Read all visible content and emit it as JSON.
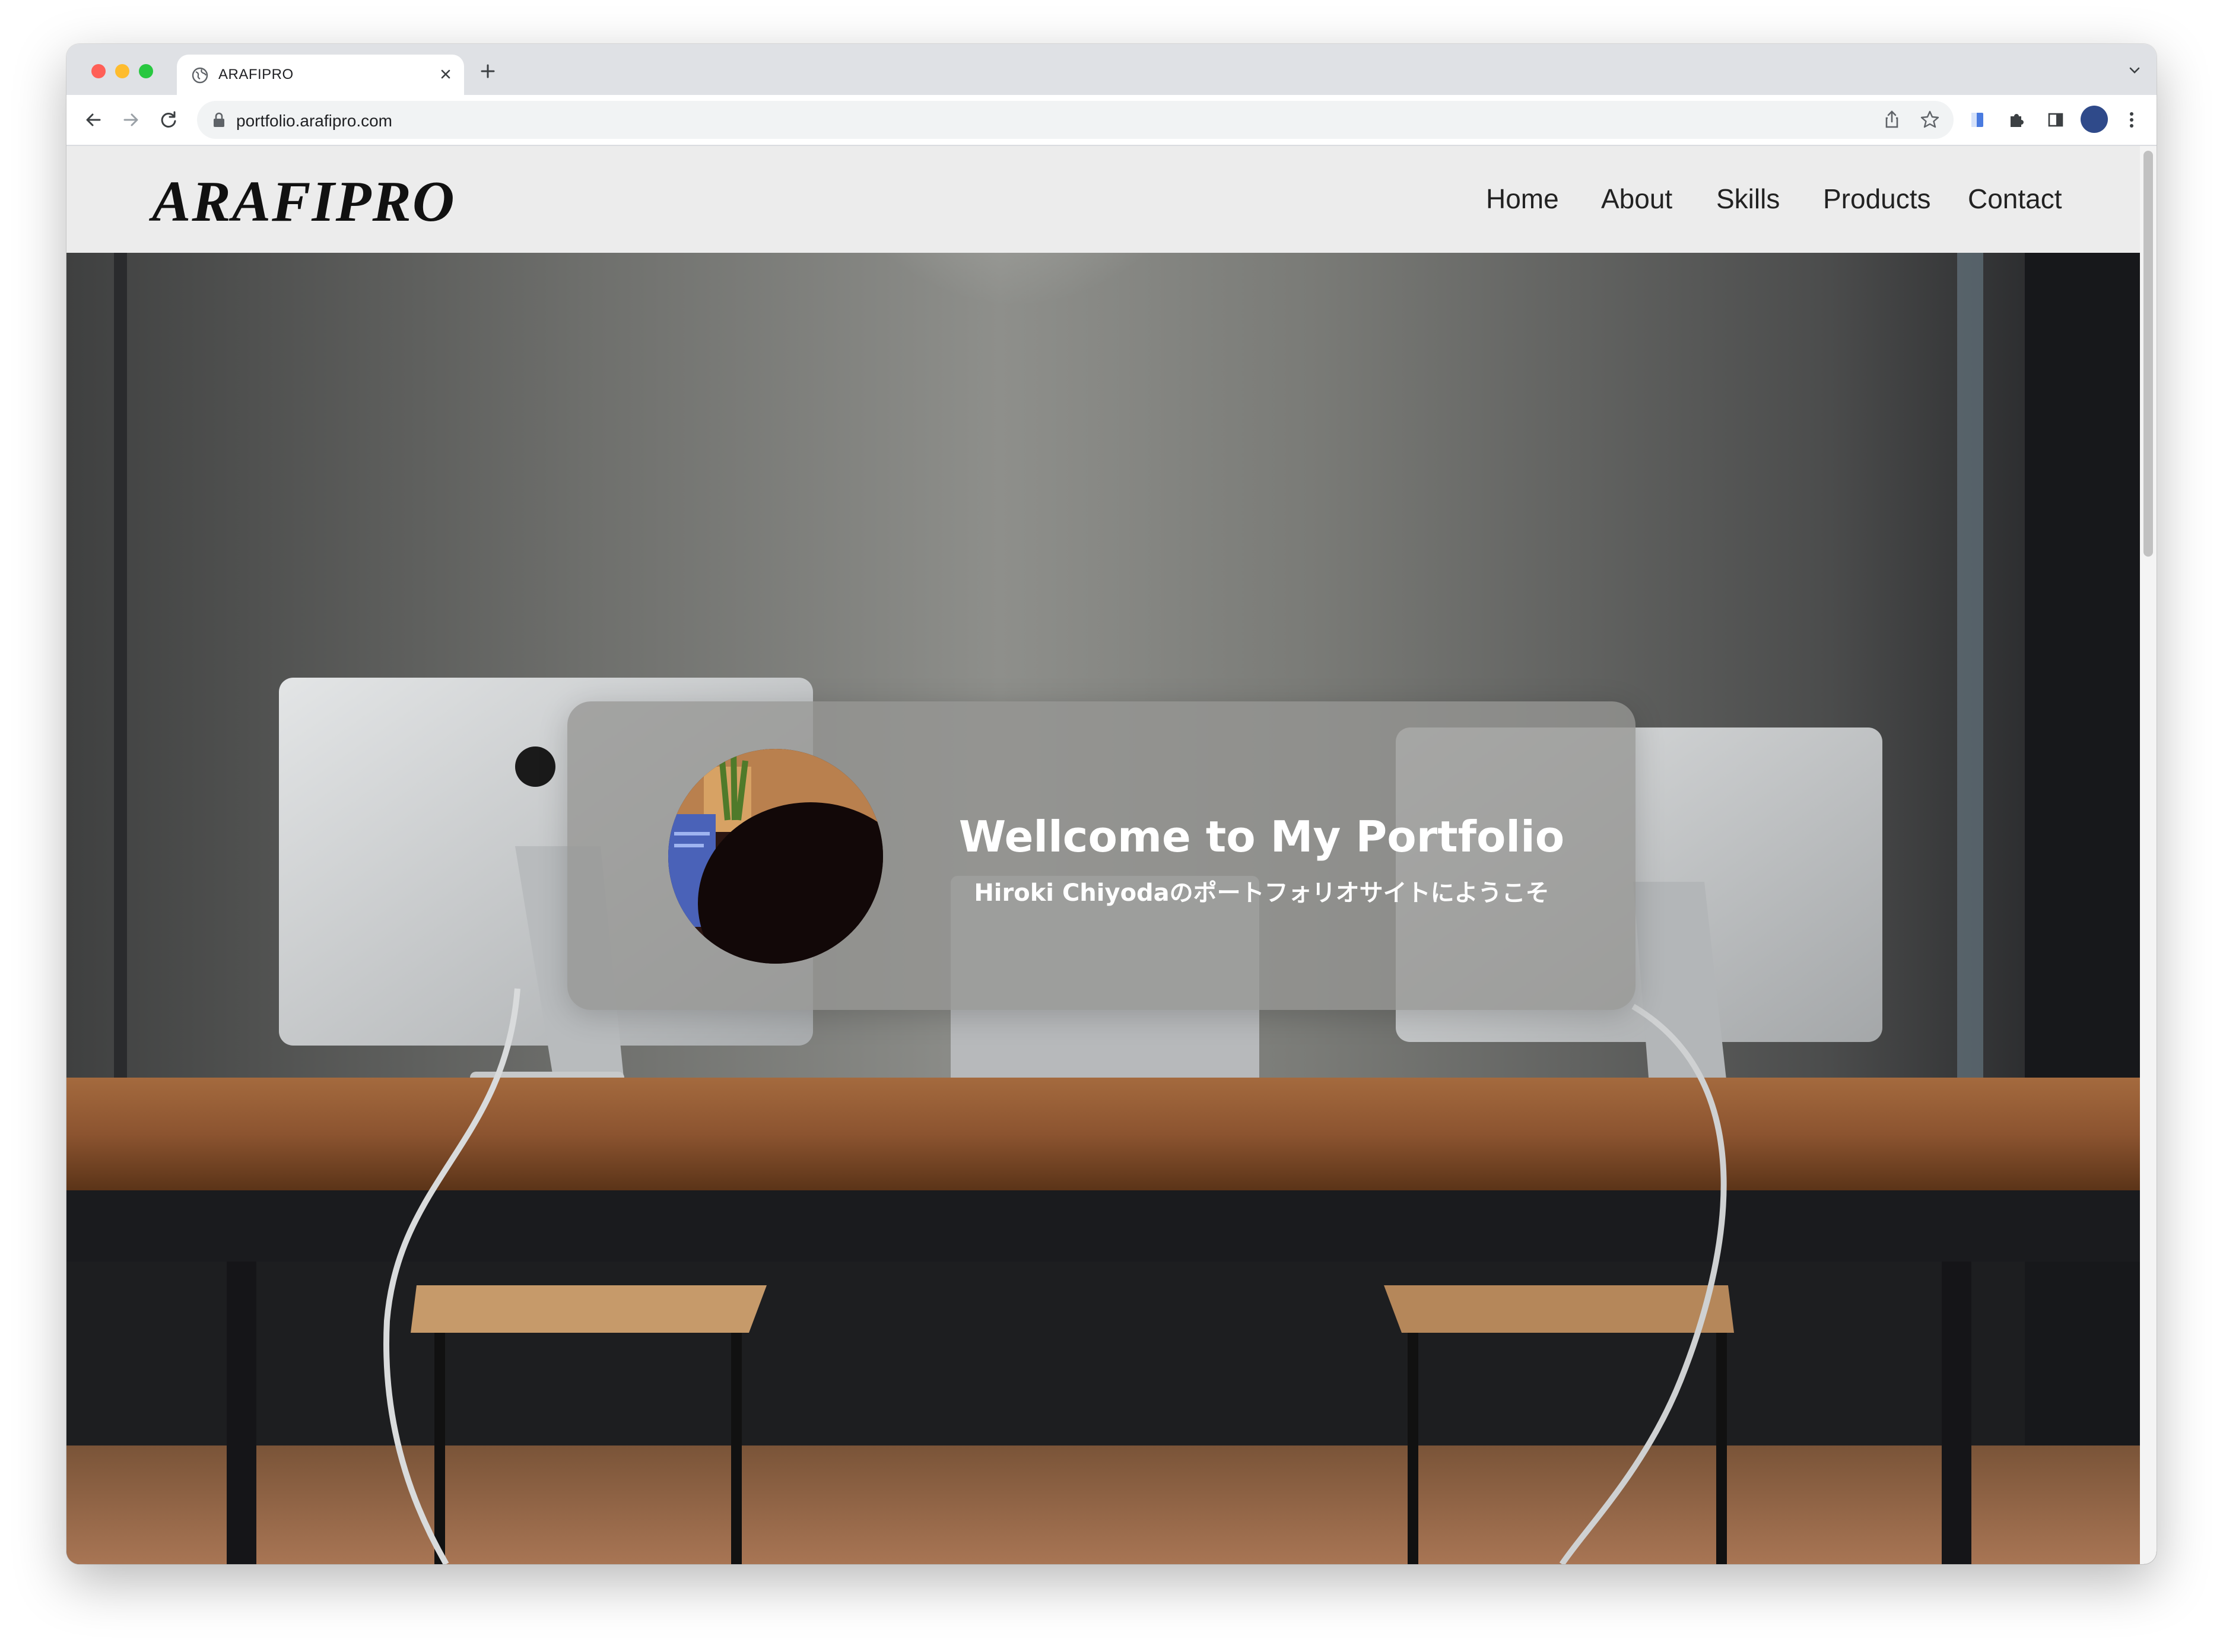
{
  "browser": {
    "tab_title": "ARAFIPRO",
    "url": "portfolio.arafipro.com"
  },
  "site": {
    "logo": "ARAFIPRO",
    "nav": [
      "Home",
      "About",
      "Skills",
      "Products",
      "Contact"
    ]
  },
  "hero": {
    "title": "Wellcome to My Portfolio",
    "subtitle": "Hiroki Chiyodaのポートフォリオサイトにようこそ"
  }
}
